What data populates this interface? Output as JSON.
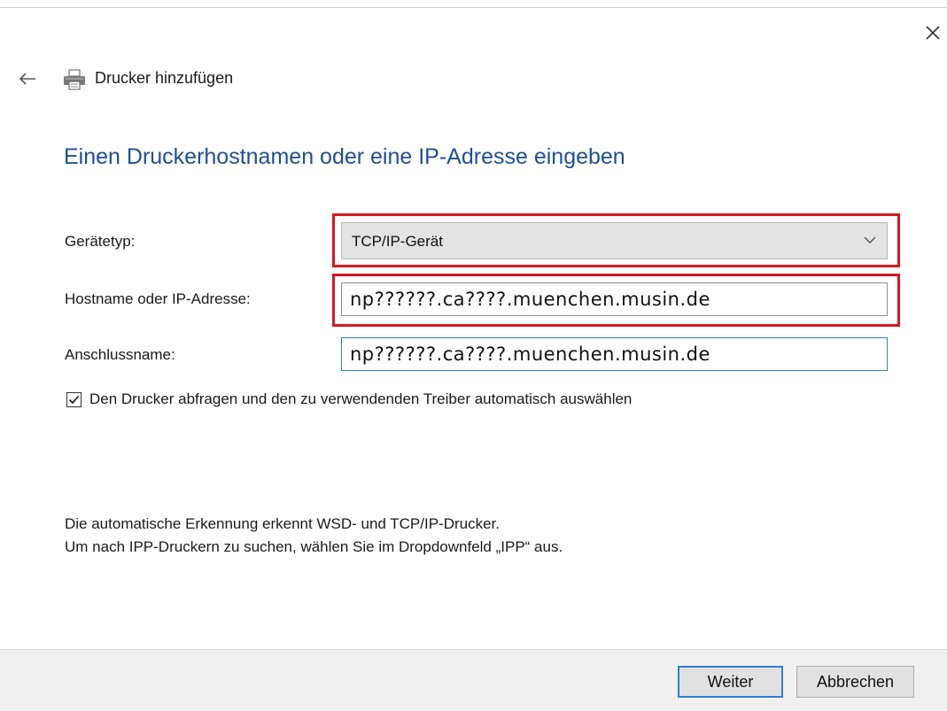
{
  "window": {
    "title": "Drucker hinzufügen",
    "close_icon": "close-icon",
    "back_icon": "back-arrow-icon",
    "app_icon": "printer-icon"
  },
  "page": {
    "heading": "Einen Druckerhostnamen oder eine IP-Adresse eingeben"
  },
  "form": {
    "device_type": {
      "label": "Gerätetyp:",
      "selected": "TCP/IP-Gerät",
      "icon": "chevron-down-icon"
    },
    "hostname": {
      "label": "Hostname oder IP-Adresse:",
      "value": "np??????.ca????.muenchen.musin.de"
    },
    "port_name": {
      "label": "Anschlussname:",
      "value": "np??????.ca????.muenchen.musin.de"
    },
    "auto_driver": {
      "label": "Den Drucker abfragen und den zu verwendenden Treiber automatisch auswählen",
      "checked": true
    }
  },
  "info": {
    "line1": "Die automatische Erkennung erkennt WSD- und TCP/IP-Drucker.",
    "line2": "Um nach IPP-Druckern zu suchen, wählen Sie im Dropdownfeld „IPP“ aus."
  },
  "buttons": {
    "next": "Weiter",
    "cancel": "Abbrechen"
  },
  "colors": {
    "heading": "#1f4f94",
    "highlight_frame": "#d71920",
    "focus_accent": "#2a7fd4"
  }
}
